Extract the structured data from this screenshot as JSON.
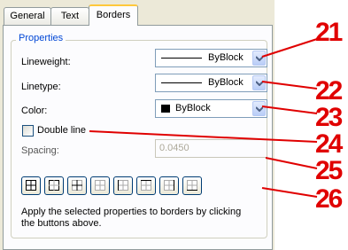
{
  "tabs": [
    {
      "label": "General",
      "active": false
    },
    {
      "label": "Text",
      "active": false
    },
    {
      "label": "Borders",
      "active": true
    }
  ],
  "properties": {
    "legend": "Properties",
    "lineweight": {
      "label": "Lineweight:",
      "value": "ByBlock"
    },
    "linetype": {
      "label": "Linetype:",
      "value": "ByBlock"
    },
    "color": {
      "label": "Color:",
      "value": "ByBlock",
      "swatch": "#000000"
    },
    "double_line": {
      "label": "Double line",
      "checked": false
    },
    "spacing": {
      "label": "Spacing:",
      "value": "0.0450",
      "enabled": false
    }
  },
  "border_buttons": [
    {
      "icon": "all-borders-icon"
    },
    {
      "icon": "outside-borders-icon"
    },
    {
      "icon": "inside-borders-icon"
    },
    {
      "icon": "no-borders-icon"
    },
    {
      "icon": "left-border-icon"
    },
    {
      "icon": "top-border-icon"
    },
    {
      "icon": "right-border-icon"
    },
    {
      "icon": "bottom-border-icon"
    }
  ],
  "hint": "Apply the selected properties to borders by clicking the buttons above.",
  "callouts": [
    "21",
    "22",
    "23",
    "24",
    "25",
    "26"
  ],
  "colors": {
    "callout": "#e00000",
    "legend": "#0046d5",
    "tab_highlight": "#ffc83c"
  }
}
